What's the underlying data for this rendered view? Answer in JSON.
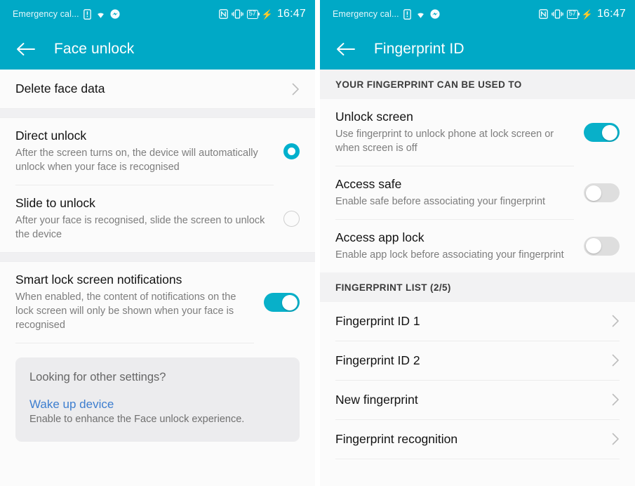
{
  "statusbar": {
    "carrier": "Emergency cal...",
    "icons": [
      "sim-card-icon",
      "wifi-icon",
      "messenger-icon"
    ],
    "right_icons": [
      "nfc-icon",
      "vibrate-icon"
    ],
    "battery_level": "57",
    "charging": "⚡",
    "time": "16:47"
  },
  "theme": {
    "accent": "#00a9c6",
    "toggle_on": "#08b0c9",
    "radio_on": "#00b0cd",
    "link": "#3d7ecf",
    "page_bg": "#fbfbfb",
    "section_bg": "#f2f2f3",
    "card_bg": "#ececee"
  },
  "left": {
    "title": "Face unlock",
    "back_icon": "back-arrow-icon",
    "delete_row": {
      "label": "Delete face data",
      "chevron": "chevron-right-icon"
    },
    "unlock_modes": [
      {
        "title": "Direct unlock",
        "subtitle": "After the screen turns on, the device will automatically unlock when your face is recognised",
        "selected": true
      },
      {
        "title": "Slide to unlock",
        "subtitle": "After your face is recognised, slide the screen to unlock the device",
        "selected": false
      }
    ],
    "smart_lock": {
      "title": "Smart lock screen notifications",
      "subtitle": "When enabled, the content of notifications on the lock screen will only be shown when your face is recognised",
      "toggle_on": true
    },
    "card": {
      "question": "Looking for other settings?",
      "link": "Wake up device",
      "description": "Enable to enhance the Face unlock experience."
    }
  },
  "right": {
    "title": "Fingerprint ID",
    "back_icon": "back-arrow-icon",
    "usage_header": "YOUR FINGERPRINT CAN BE USED TO",
    "usage_items": [
      {
        "title": "Unlock screen",
        "subtitle": "Use fingerprint to unlock phone at lock screen or when screen is off",
        "toggle_on": true
      },
      {
        "title": "Access safe",
        "subtitle": "Enable safe before associating your fingerprint",
        "toggle_on": false
      },
      {
        "title": "Access app lock",
        "subtitle": "Enable app lock before associating your fingerprint",
        "toggle_on": false
      }
    ],
    "list_header": "FINGERPRINT LIST (2/5)",
    "list_items": [
      {
        "label": "Fingerprint ID 1",
        "chevron": "chevron-right-icon"
      },
      {
        "label": "Fingerprint ID 2",
        "chevron": "chevron-right-icon"
      },
      {
        "label": "New fingerprint",
        "chevron": "chevron-right-icon"
      },
      {
        "label": "Fingerprint recognition",
        "chevron": "chevron-right-icon"
      }
    ]
  }
}
